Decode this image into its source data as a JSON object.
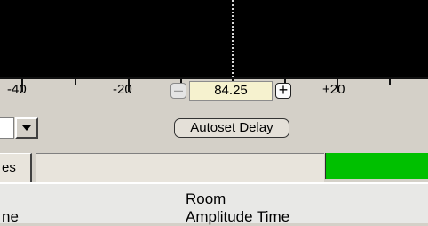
{
  "ruler": {
    "labels": [
      "-40",
      "-20",
      "+20"
    ]
  },
  "delay_control": {
    "minus_label": "–",
    "value": "84.25",
    "plus_label": "+"
  },
  "autoset_button": {
    "label": "Autoset Delay"
  },
  "tabs": {
    "partial_label": "es"
  },
  "table_header": {
    "left_partial": "ne",
    "room_label": "Room",
    "amplitude_time_label": "Amplitude Time"
  },
  "colors": {
    "scope_background": "#000000",
    "indicator_green": "#00c000",
    "value_field_background": "#f6f2cf"
  },
  "icons": {
    "dropdown": "chevron-down-icon"
  }
}
